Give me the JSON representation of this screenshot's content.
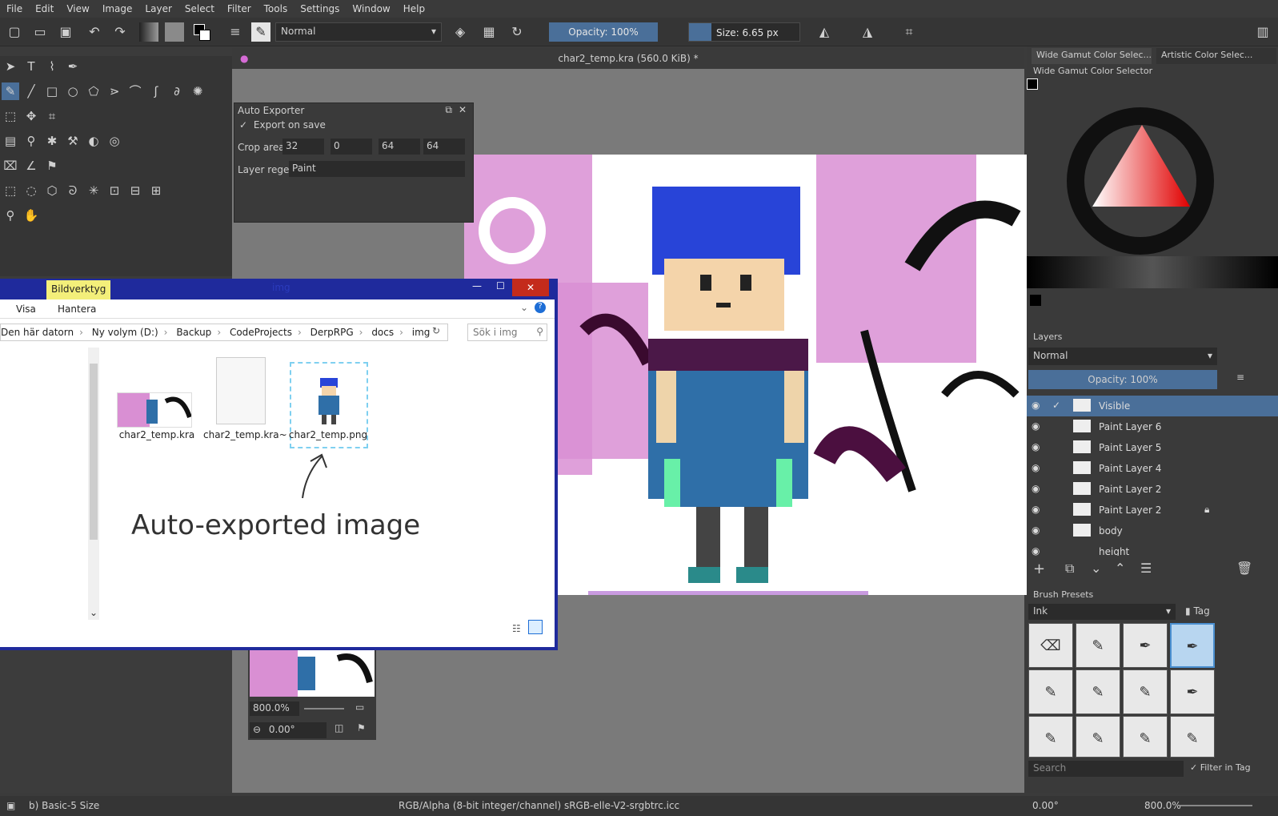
{
  "menubar": {
    "items": [
      "File",
      "Edit",
      "View",
      "Image",
      "Layer",
      "Select",
      "Filter",
      "Tools",
      "Settings",
      "Window",
      "Help"
    ]
  },
  "toolbar": {
    "blend_mode": "Normal",
    "opacity": "Opacity: 100%",
    "size": "Size: 6.65 px"
  },
  "document": {
    "title": "char2_temp.kra (560.0 KiB) *"
  },
  "auto_exporter": {
    "title": "Auto Exporter",
    "export_on_save": "Export on save",
    "crop_label": "Crop area:",
    "crop_values": [
      "32",
      "0",
      "64",
      "64"
    ],
    "regex_label": "Layer regex:",
    "regex_value": "Paint"
  },
  "explorer": {
    "ribbon_tab": "Bildverktyg",
    "title": "img",
    "tabs": [
      "Visa",
      "Hantera"
    ],
    "breadcrumb": [
      "Den här datorn",
      "Ny volym (D:)",
      "Backup",
      "CodeProjects",
      "DerpRPG",
      "docs",
      "img"
    ],
    "search_placeholder": "Sök i img",
    "files": [
      {
        "name": "char2_temp.kra"
      },
      {
        "name": "char2_temp.kra~"
      },
      {
        "name": "char2_temp.png"
      }
    ],
    "annotation": "Auto-exported image"
  },
  "overview": {
    "zoom": "800.0%",
    "rotation": "0.00°"
  },
  "color_selector": {
    "tabs": [
      "Wide Gamut Color Selec...",
      "Artistic Color Selec..."
    ],
    "title": "Wide Gamut Color Selector"
  },
  "layers": {
    "title": "Layers",
    "blend_mode": "Normal",
    "opacity": "Opacity:  100%",
    "items": [
      {
        "name": "Visible"
      },
      {
        "name": "Paint Layer 6"
      },
      {
        "name": "Paint Layer 5"
      },
      {
        "name": "Paint Layer 4"
      },
      {
        "name": "Paint Layer 2"
      },
      {
        "name": "Paint Layer 2"
      },
      {
        "name": "body"
      },
      {
        "name": "height"
      }
    ]
  },
  "brush_presets": {
    "title": "Brush Presets",
    "tag": "Ink",
    "tag_button": "Tag",
    "search_placeholder": "Search",
    "filter_label": "Filter in Tag"
  },
  "status": {
    "brush": "b) Basic-5 Size",
    "color_profile": "RGB/Alpha (8-bit integer/channel)  sRGB-elle-V2-srgbtrc.icc",
    "rotation": "0.00°",
    "zoom": "800.0%"
  },
  "colors": {
    "accent": "#4a6f99",
    "explorer_frame": "#1f2a9c",
    "close_red": "#c42b1c",
    "ribbon_yellow": "#f3ef7a"
  }
}
